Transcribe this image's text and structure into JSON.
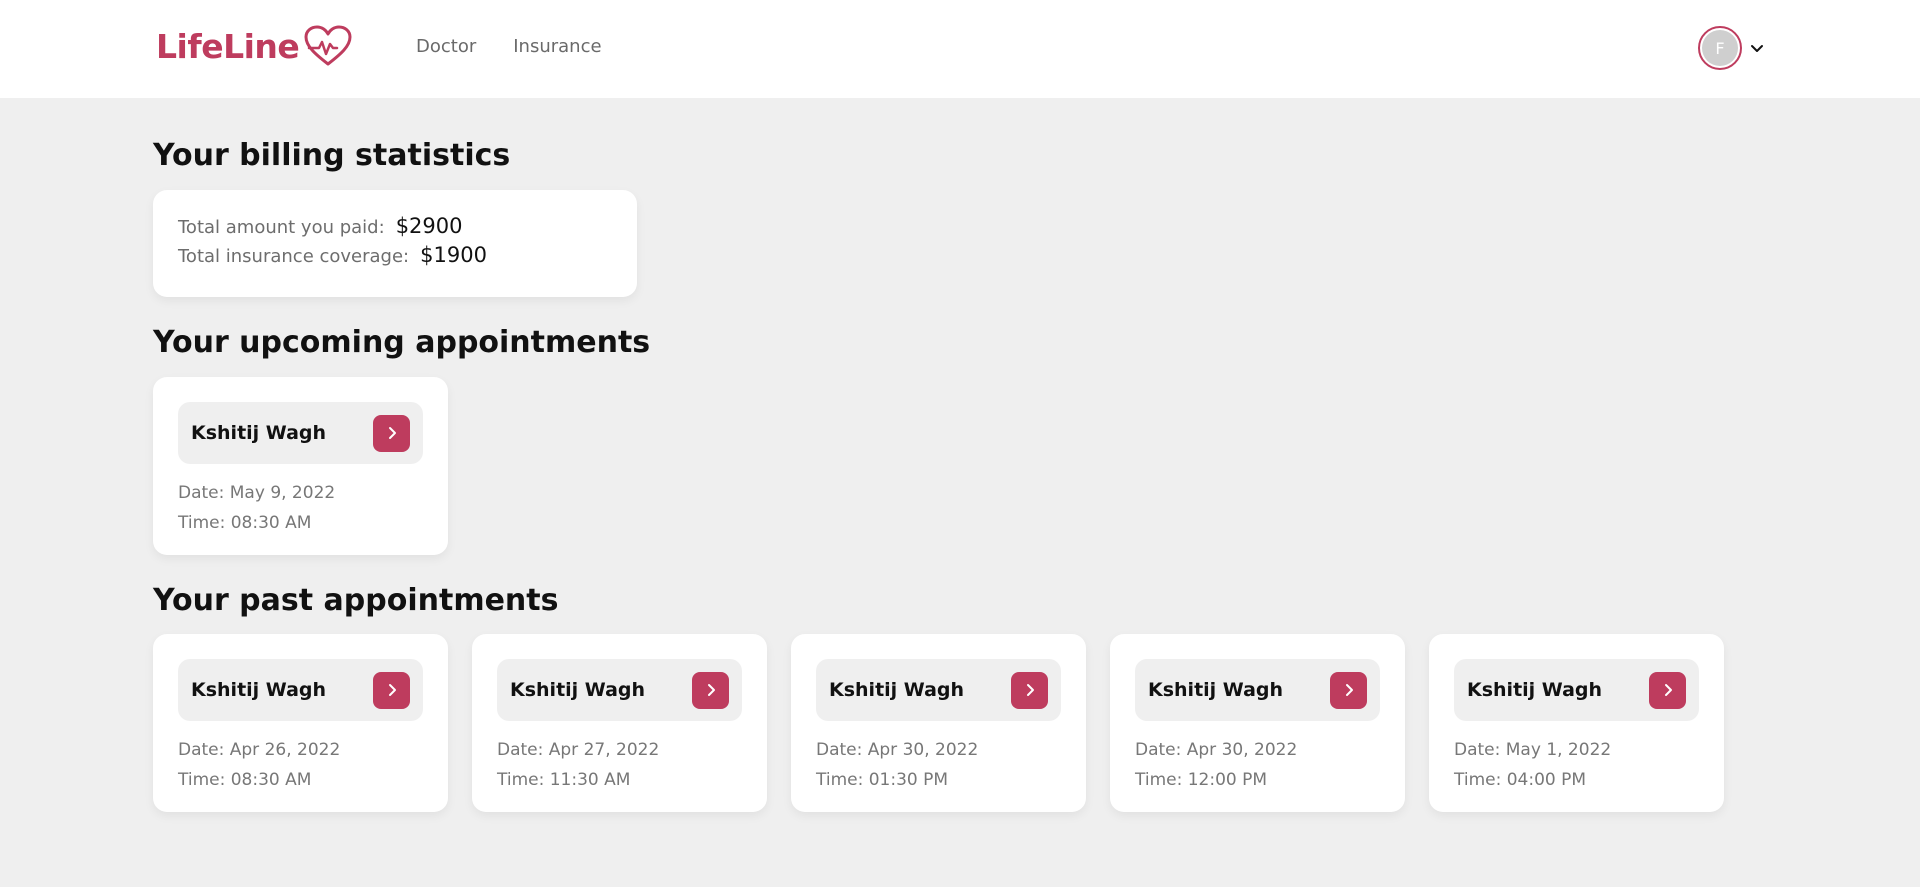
{
  "brand": {
    "name": "LifeLine",
    "color": "#be3c5e",
    "icon": "heart-pulse-icon"
  },
  "nav": [
    {
      "label": "Doctor"
    },
    {
      "label": "Insurance"
    }
  ],
  "user": {
    "initial": "F",
    "menu_icon": "chevron-down-icon"
  },
  "billing": {
    "heading": "Your billing statistics",
    "paid_label": "Total amount you paid:",
    "paid_value": "$2900",
    "coverage_label": "Total insurance coverage:",
    "coverage_value": "$1900"
  },
  "upcoming": {
    "heading": "Your upcoming appointments",
    "items": [
      {
        "name": "Kshitij Wagh",
        "date": "Date: May 9, 2022",
        "time": "Time: 08:30 AM"
      }
    ]
  },
  "past": {
    "heading": "Your past appointments",
    "items": [
      {
        "name": "Kshitij Wagh",
        "date": "Date: Apr 26, 2022",
        "time": "Time: 08:30 AM"
      },
      {
        "name": "Kshitij Wagh",
        "date": "Date: Apr 27, 2022",
        "time": "Time: 11:30 AM"
      },
      {
        "name": "Kshitij Wagh",
        "date": "Date: Apr 30, 2022",
        "time": "Time: 01:30 PM"
      },
      {
        "name": "Kshitij Wagh",
        "date": "Date: Apr 30, 2022",
        "time": "Time: 12:00 PM"
      },
      {
        "name": "Kshitij Wagh",
        "date": "Date: May 1, 2022",
        "time": "Time: 04:00 PM"
      }
    ]
  }
}
